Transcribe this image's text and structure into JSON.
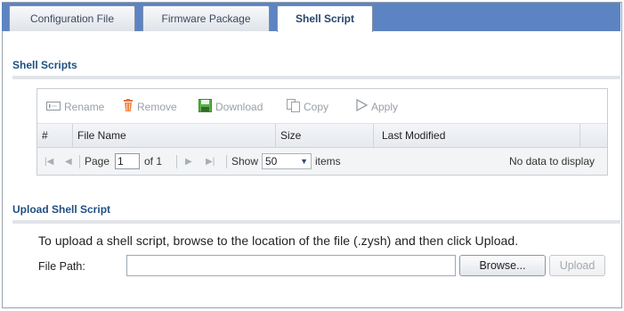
{
  "tabs": [
    {
      "label": "Configuration File",
      "active": false
    },
    {
      "label": "Firmware Package",
      "active": false
    },
    {
      "label": "Shell Script",
      "active": true
    }
  ],
  "shell_scripts": {
    "title": "Shell Scripts",
    "toolbar": {
      "rename": "Rename",
      "remove": "Remove",
      "download": "Download",
      "copy": "Copy",
      "apply": "Apply"
    },
    "columns": [
      "#",
      "File Name",
      "Size",
      "Last Modified"
    ],
    "rows": [],
    "pager": {
      "page_label": "Page",
      "page_value": "1",
      "of_label": "of 1",
      "show_label": "Show",
      "show_value": "50",
      "items_label": "items",
      "empty_text": "No data to display"
    }
  },
  "upload": {
    "title": "Upload Shell Script",
    "description": "To upload a shell script, browse to the location of the file (.zysh) and then click Upload.",
    "file_path_label": "File Path:",
    "file_path_value": "",
    "browse_label": "Browse...",
    "upload_label": "Upload"
  },
  "colors": {
    "tab_strip": "#5d84c2",
    "section_title": "#1f4f82",
    "disabled_text": "#9aa0a8",
    "remove_icon": "#e8743b",
    "download_icon": "#4a9e3a"
  }
}
